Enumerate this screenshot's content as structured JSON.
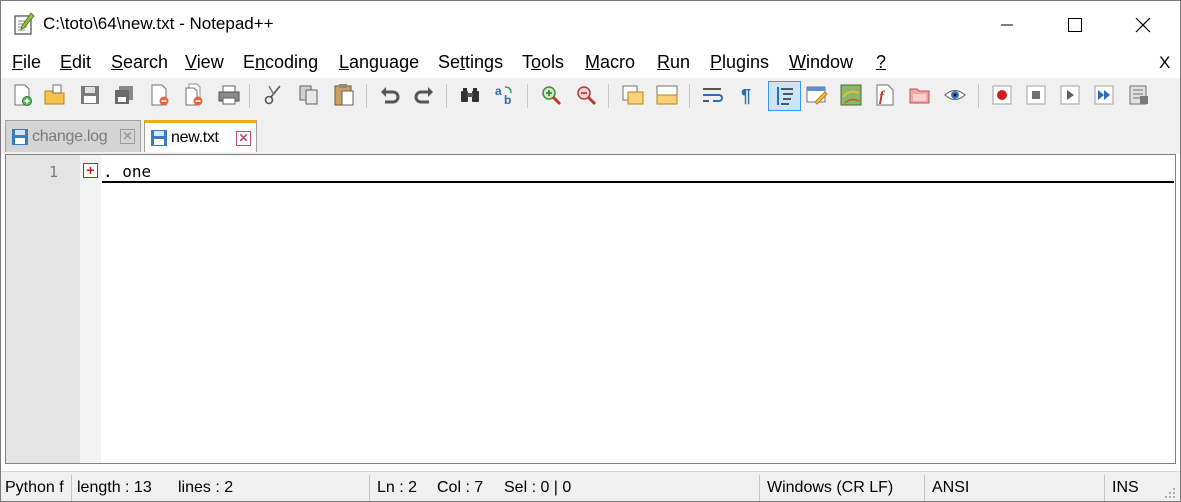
{
  "window": {
    "title": "C:\\toto\\64\\new.txt - Notepad++",
    "controls": {
      "minimize": "minimize",
      "maximize": "maximize",
      "close": "close"
    }
  },
  "menu": {
    "items": [
      {
        "label": "File",
        "hotkey": "F",
        "rest": "ile"
      },
      {
        "label": "Edit",
        "hotkey": "E",
        "rest": "dit"
      },
      {
        "label": "Search",
        "hotkey": "S",
        "rest": "earch"
      },
      {
        "label": "View",
        "hotkey": "V",
        "rest": "iew"
      },
      {
        "label": "Encoding",
        "hotkey": "n",
        "pre": "E",
        "rest": "coding"
      },
      {
        "label": "Language",
        "hotkey": "L",
        "rest": "anguage"
      },
      {
        "label": "Settings",
        "hotkey": "t",
        "pre": "Se",
        "rest": "tings"
      },
      {
        "label": "Tools",
        "hotkey": "o",
        "pre": "T",
        "rest": "ols"
      },
      {
        "label": "Macro",
        "hotkey": "M",
        "rest": "acro"
      },
      {
        "label": "Run",
        "hotkey": "R",
        "rest": "un"
      },
      {
        "label": "Plugins",
        "hotkey": "P",
        "rest": "lugins"
      },
      {
        "label": "Window",
        "hotkey": "W",
        "rest": "indow"
      },
      {
        "label": "?",
        "hotkey": "?",
        "rest": ""
      }
    ],
    "close_doc": "X"
  },
  "toolbar": {
    "buttons": [
      "new-file",
      "open-file",
      "save",
      "save-all",
      "close",
      "close-all",
      "print",
      "cut",
      "copy",
      "paste",
      "undo",
      "redo",
      "find",
      "replace",
      "zoom-in",
      "zoom-out",
      "sync-vertical",
      "sync-horizontal",
      "word-wrap",
      "show-all-chars",
      "indent-guide",
      "user-defined-lang",
      "doc-map",
      "function-list",
      "folder-as-workspace",
      "monitoring",
      "record-macro",
      "stop-record",
      "playback-macro",
      "run-macro-multiple",
      "save-macro"
    ],
    "active": "indent-guide"
  },
  "tabs": [
    {
      "label": "change.log",
      "active": false,
      "close": "✕"
    },
    {
      "label": "new.txt",
      "active": true,
      "close": "✕"
    }
  ],
  "editor": {
    "lines": [
      {
        "number": "1",
        "text": ". one",
        "folded": true,
        "fold_marker": "+"
      }
    ]
  },
  "status": {
    "language": "Python f",
    "length": "length : 13",
    "lines": "lines : 2",
    "ln": "Ln : 2",
    "col": "Col : 7",
    "sel": "Sel : 0 | 0",
    "eol": "Windows (CR LF)",
    "encoding": "ANSI",
    "mode": "INS"
  }
}
